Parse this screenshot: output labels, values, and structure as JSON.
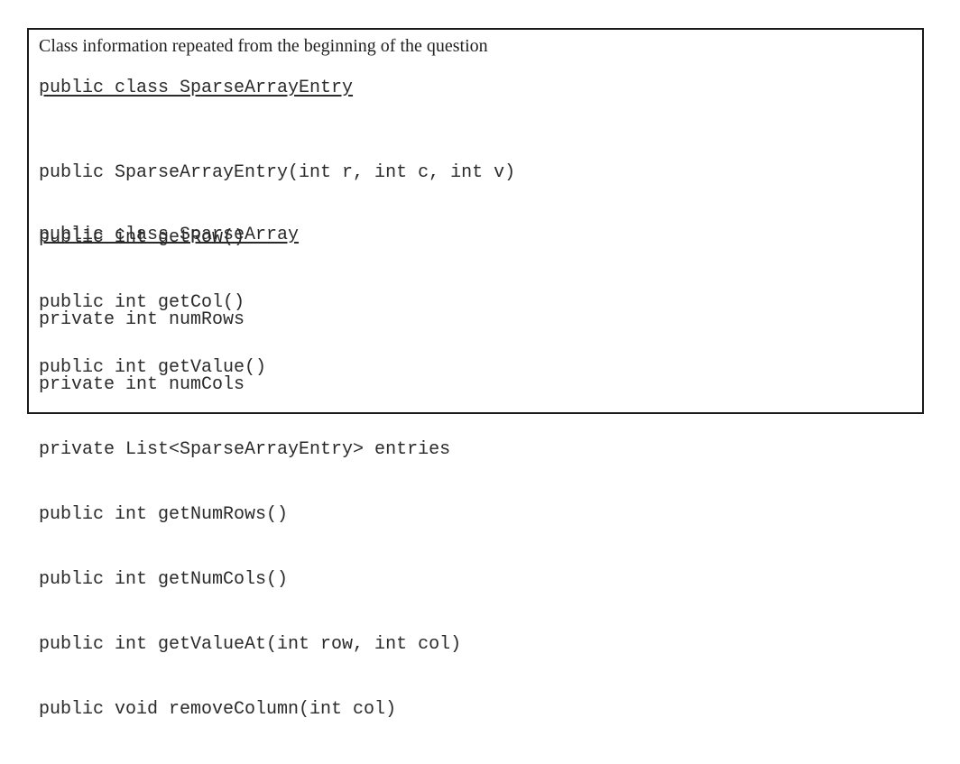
{
  "heading": "Class information repeated from the beginning of the question",
  "classes": [
    {
      "title": "public class SparseArrayEntry",
      "members": [
        "public SparseArrayEntry(int r, int c, int v)",
        "public int getRow()",
        "public int getCol()",
        "public int getValue()"
      ]
    },
    {
      "title": "public class SparseArray",
      "members": [
        "private int numRows",
        "private int numCols",
        "private List<SparseArrayEntry> entries",
        "public int getNumRows()",
        "public int getNumCols()",
        "public int getValueAt(int row, int col)",
        "public void removeColumn(int col)"
      ]
    }
  ]
}
